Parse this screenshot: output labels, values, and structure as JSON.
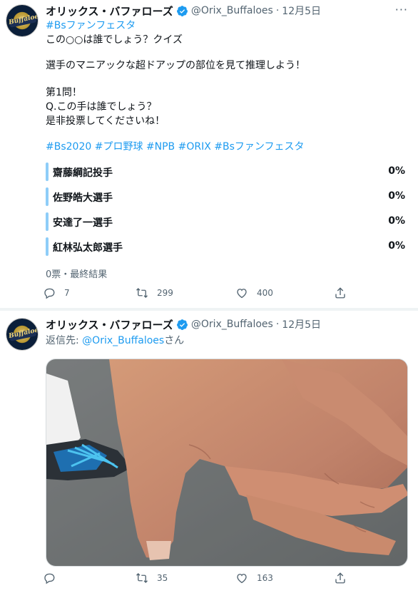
{
  "tweets": [
    {
      "author": {
        "name": "オリックス・バファローズ",
        "handle": "@Orix_Buffaloes",
        "avatar_text": "Buffaloes"
      },
      "date": "12月5日",
      "more_label": "···",
      "lines": [
        {
          "text": "#Bsファンフェスタ",
          "style": "link"
        },
        {
          "text": "この○○は誰でしょう？クイズ",
          "style": "plain"
        },
        {
          "text": "選手のマニアックな超ドアップの部位を見て推理しよう！",
          "style": "plain"
        },
        {
          "text": "第1問！",
          "style": "plain"
        },
        {
          "text": "Q.この手は誰でしょう？",
          "style": "plain"
        },
        {
          "text": "是非投票してくださいね！",
          "style": "plain"
        },
        {
          "text": "#Bs2020 #プロ野球 #NPB #ORIX #Bsファンフェスタ",
          "style": "link"
        }
      ],
      "poll": {
        "options": [
          {
            "label": "齋藤綱記投手",
            "percent": "0%"
          },
          {
            "label": "佐野皓大選手",
            "percent": "0%"
          },
          {
            "label": "安達了一選手",
            "percent": "0%"
          },
          {
            "label": "紅林弘太郎選手",
            "percent": "0%"
          }
        ],
        "summary": "0票・最終結果"
      },
      "actions": {
        "replies": "7",
        "retweets": "299",
        "likes": "400"
      }
    },
    {
      "author": {
        "name": "オリックス・バファローズ",
        "handle": "@Orix_Buffaloes",
        "avatar_text": "Buffaloes"
      },
      "date": "12月5日",
      "reply_to": {
        "prefix": "返信先: ",
        "handle": "@Orix_Buffaloes",
        "suffix": "さん"
      },
      "actions": {
        "replies": "",
        "retweets": "35",
        "likes": "163"
      }
    }
  ],
  "colors": {
    "link": "#1d9bf0",
    "secondary": "#536471",
    "verified": "#1d9bf0",
    "poll_bar": "#8ecdf8"
  },
  "icons": [
    "verified-badge-icon",
    "reply-icon",
    "retweet-icon",
    "like-icon",
    "share-icon",
    "more-icon"
  ]
}
